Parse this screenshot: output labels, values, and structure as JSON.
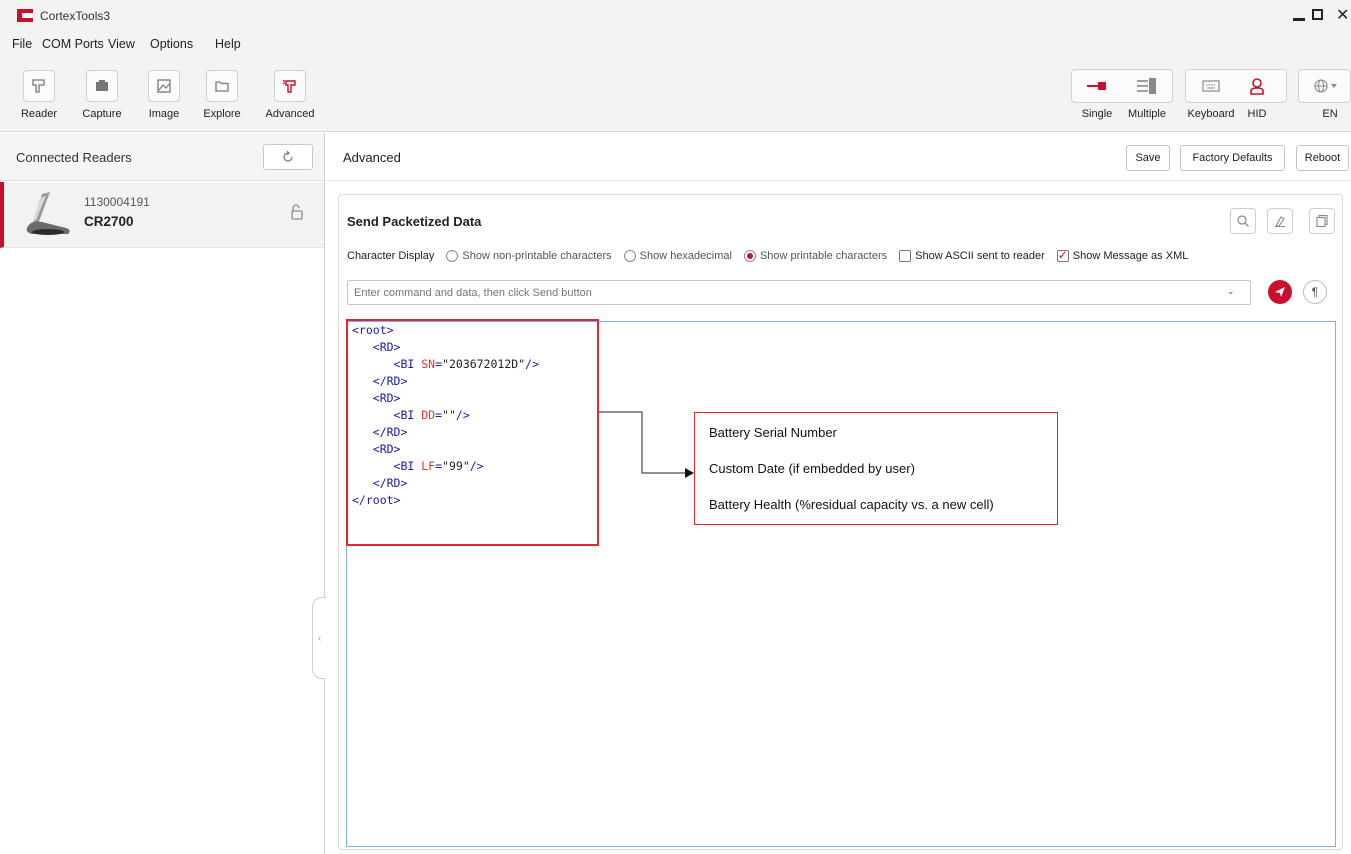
{
  "app": {
    "title": "CortexTools3",
    "menus": [
      "File",
      "COM Ports",
      "View",
      "Options",
      "Help"
    ],
    "brand_color": "#c8102e"
  },
  "toolbar": {
    "left_tools": [
      {
        "label": "Reader",
        "icon": "reader-icon"
      },
      {
        "label": "Capture",
        "icon": "capture-icon"
      },
      {
        "label": "Image",
        "icon": "image-icon"
      },
      {
        "label": "Explore",
        "icon": "folder-icon"
      },
      {
        "label": "Advanced",
        "icon": "advanced-icon"
      }
    ],
    "right_tools": [
      {
        "label": "Single",
        "icon": "single-connection-icon"
      },
      {
        "label": "Multiple",
        "icon": "multiple-connection-icon"
      },
      {
        "label": "Keyboard",
        "icon": "keyboard-icon"
      },
      {
        "label": "HID",
        "icon": "hid-user-icon"
      },
      {
        "label": "EN",
        "icon": "globe-icon"
      }
    ]
  },
  "left_panel": {
    "title": "Connected Readers",
    "readers": [
      {
        "serial": "1130004191",
        "model": "CR2700"
      }
    ]
  },
  "main": {
    "title": "Advanced",
    "buttons": {
      "save": "Save",
      "factory_defaults": "Factory Defaults",
      "reboot": "Reboot"
    },
    "card": {
      "title": "Send Packetized Data",
      "character_display_label": "Character Display",
      "options": {
        "non_printable": "Show non-printable characters",
        "hexadecimal": "Show hexadecimal",
        "printable": "Show printable characters",
        "ascii_sent": "Show ASCII sent to reader",
        "as_xml": "Show Message as XML"
      },
      "selected_option": "printable",
      "ascii_sent_checked": false,
      "as_xml_checked": true,
      "command_placeholder": "Enter command and data, then click Send button"
    }
  },
  "xml_output": {
    "root_open": "<root>",
    "root_close": "</root>",
    "rd_open": "<RD>",
    "rd_close": "</RD>",
    "bi_open": "<BI ",
    "self_close": "/>",
    "entries": [
      {
        "attr": "SN",
        "value": "\"203672012D\""
      },
      {
        "attr": "DD",
        "value": "\"\""
      },
      {
        "attr": "LF",
        "value": "\"99\""
      }
    ]
  },
  "annotation": {
    "lines": [
      "Battery Serial Number",
      "Custom Date (if embedded by user)",
      "Battery Health (%residual capacity vs. a new cell)"
    ]
  }
}
